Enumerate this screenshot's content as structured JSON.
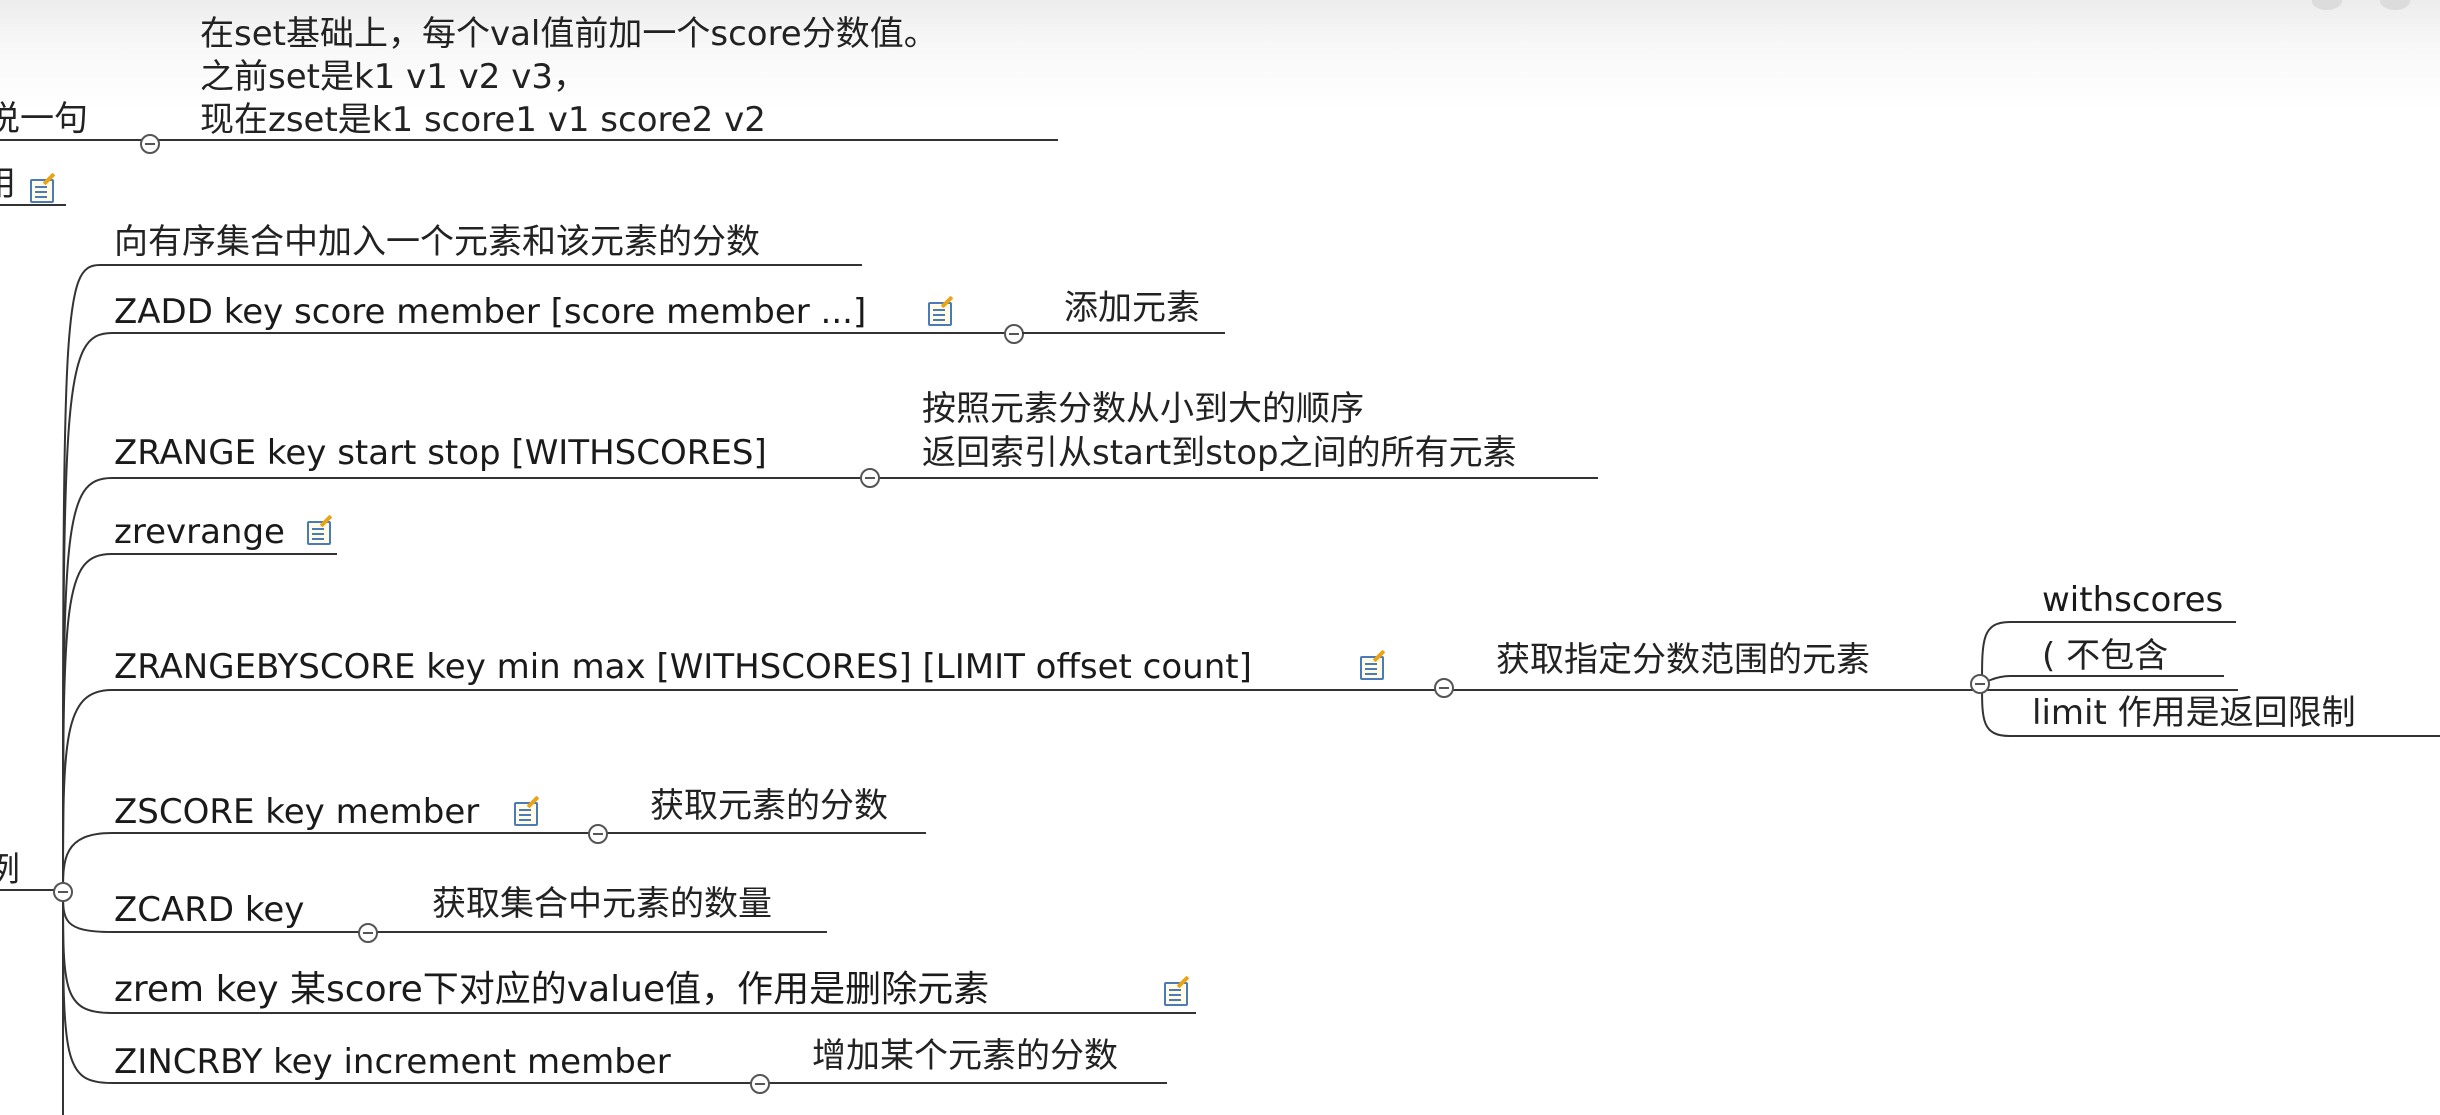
{
  "top_note": {
    "line1": "在set基础上，每个val值前加一个score分数值。",
    "line2": "之前set是k1    v1 v2 v3，",
    "line3": "现在zset是k1 score1 v1 score2 v2"
  },
  "left_partial": {
    "a": "说一句",
    "b": "用",
    "c": "例"
  },
  "branches": {
    "intro": "向有序集合中加入一个元素和该元素的分数",
    "zadd": {
      "cmd": "ZADD key score member [score member ...]",
      "desc": "添加元素"
    },
    "zrange": {
      "cmd": "ZRANGE key start stop [WITHSCORES]",
      "desc_line1": "按照元素分数从小到大的顺序",
      "desc_line2": "返回索引从start到stop之间的所有元素"
    },
    "zrevrange": {
      "cmd": "zrevrange"
    },
    "zrangebyscore": {
      "cmd": "ZRANGEBYSCORE key min max [WITHSCORES] [LIMIT offset count]",
      "desc": "获取指定分数范围的元素",
      "sub1": "withscores",
      "sub2": "(    不包含",
      "sub3": "limit 作用是返回限制"
    },
    "zscore": {
      "cmd": "ZSCORE key member",
      "desc": "获取元素的分数"
    },
    "zcard": {
      "cmd": "ZCARD key",
      "desc": "获取集合中元素的数量"
    },
    "zrem": {
      "cmd": "zrem key 某score下对应的value值，作用是删除元素"
    },
    "zincrby": {
      "cmd": "ZINCRBY key increment member",
      "desc": "增加某个元素的分数"
    }
  },
  "icons": {
    "note": "note-edit-icon",
    "collapse": "collapse-minus-icon"
  },
  "colors": {
    "line": "#333333",
    "text": "#1a1a1a",
    "note_border": "#4a7bb7",
    "note_pencil": "#e8a317"
  }
}
